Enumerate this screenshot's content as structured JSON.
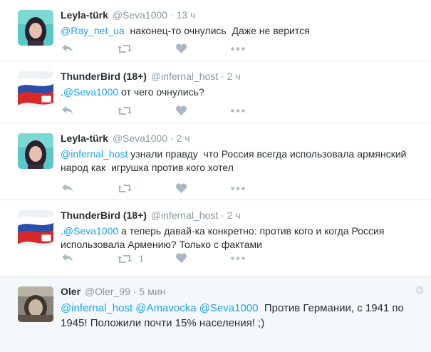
{
  "tweets": [
    {
      "name": "Leyla-türk",
      "handle": "@Seva1000",
      "sep": "·",
      "time": "13 ч",
      "mention": "@Ray_net_ua",
      "text": "  наконец-то очнулись  Даже не верится",
      "retweet_count": ""
    },
    {
      "name": "ThunderBird (18+)",
      "handle": "@infernal_host",
      "sep": "·",
      "time": "2 ч",
      "prefix": ".",
      "mention": "@Seva1000",
      "text": " от чего очнулись?",
      "retweet_count": ""
    },
    {
      "name": "Leyla-türk",
      "handle": "@Seva1000",
      "sep": "·",
      "time": "2 ч",
      "mention": "@infernal_host",
      "text": " узнали правду  что Россия всегда использовала армянский народ как  игрушка против кого хотел",
      "retweet_count": ""
    },
    {
      "name": "ThunderBird (18+)",
      "handle": "@infernal_host",
      "sep": "·",
      "time": "2 ч",
      "prefix": ".",
      "mention": "@Seva1000",
      "text": " а теперь давай-ка конкретно: против кого и когда Россия использовала Армению? Только с фактами",
      "retweet_count": "1"
    },
    {
      "name": "Oler",
      "handle": "@Oler_99",
      "sep": "·",
      "time": "5 мин",
      "mention": "@infernal_host @Amavocka @Seva1000",
      "text": "  Против Германии, с 1941 по 1945! Положили почти 15% населения! ;)",
      "retweet_count": ""
    }
  ],
  "colors": {
    "mention": "#1da1f2",
    "meta": "#8899a6",
    "icon": "#aab8c2",
    "divider": "#e1e8ed"
  },
  "icons": [
    "reply-icon",
    "retweet-icon",
    "like-icon",
    "more-icon",
    "caret-icon"
  ]
}
